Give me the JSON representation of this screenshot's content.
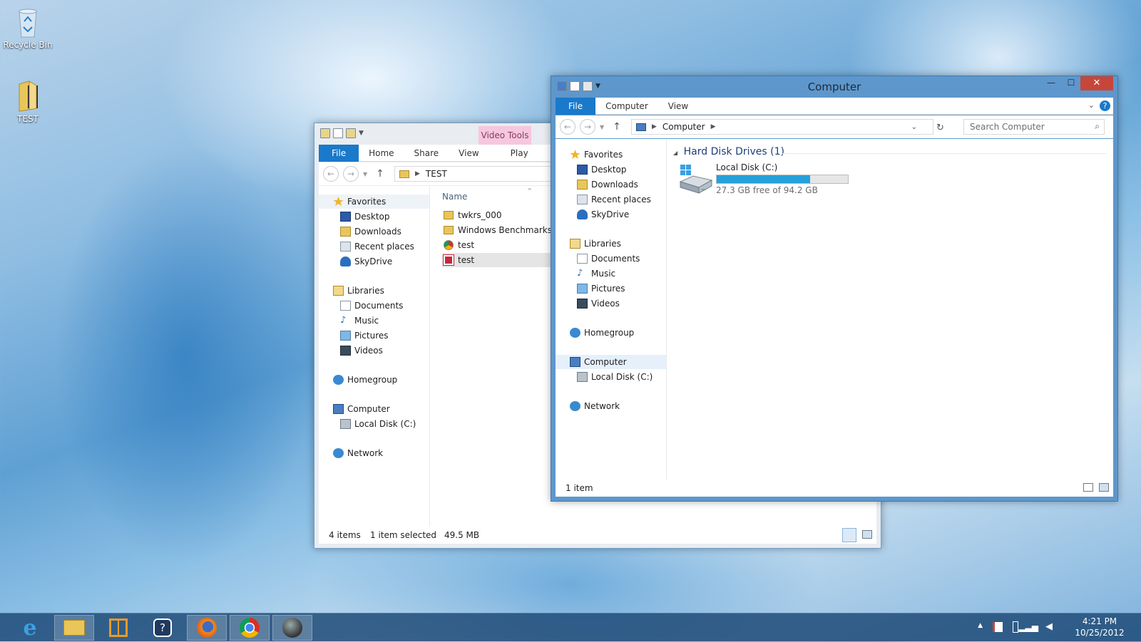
{
  "desktop": {
    "icons": [
      {
        "label": "Recycle Bin",
        "icon": "recycle-bin-icon"
      },
      {
        "label": "TEST",
        "icon": "folder-icon"
      }
    ]
  },
  "test_window": {
    "context_tab": "Video Tools",
    "tabs": [
      "File",
      "Home",
      "Share",
      "View",
      "Play"
    ],
    "path": "TEST",
    "column_name": "Name",
    "nav": {
      "favorites": "Favorites",
      "desktop": "Desktop",
      "downloads": "Downloads",
      "recent": "Recent places",
      "skydrive": "SkyDrive",
      "libraries": "Libraries",
      "documents": "Documents",
      "music": "Music",
      "pictures": "Pictures",
      "videos": "Videos",
      "homegroup": "Homegroup",
      "computer": "Computer",
      "localdisk": "Local Disk (C:)",
      "network": "Network"
    },
    "files": [
      {
        "name": "twkrs_000",
        "icon": "folder-icon"
      },
      {
        "name": "Windows Benchmarks",
        "icon": "folder-icon"
      },
      {
        "name": "test",
        "icon": "chrome-file-icon"
      },
      {
        "name": "test",
        "icon": "video-file-icon"
      }
    ],
    "status": {
      "items": "4 items",
      "selected": "1 item selected",
      "size": "49.5 MB"
    }
  },
  "computer_window": {
    "title": "Computer",
    "tabs": [
      "File",
      "Computer",
      "View"
    ],
    "path": "Computer",
    "search_placeholder": "Search Computer",
    "nav": {
      "favorites": "Favorites",
      "desktop": "Desktop",
      "downloads": "Downloads",
      "recent": "Recent places",
      "skydrive": "SkyDrive",
      "libraries": "Libraries",
      "documents": "Documents",
      "music": "Music",
      "pictures": "Pictures",
      "videos": "Videos",
      "homegroup": "Homegroup",
      "computer": "Computer",
      "localdisk": "Local Disk (C:)",
      "network": "Network"
    },
    "group_header": "Hard Disk Drives (1)",
    "drive": {
      "name": "Local Disk (C:)",
      "free_text": "27.3 GB free of 94.2 GB",
      "used_fraction": 0.71
    },
    "status": "1 item",
    "accent": "#1979ca"
  },
  "taskbar": {
    "apps": [
      "internet-explorer-icon",
      "file-explorer-icon",
      "app-icon",
      "help-icon",
      "firefox-icon",
      "chrome-icon",
      "media-icon"
    ],
    "time": "4:21 PM",
    "date": "10/25/2012"
  }
}
